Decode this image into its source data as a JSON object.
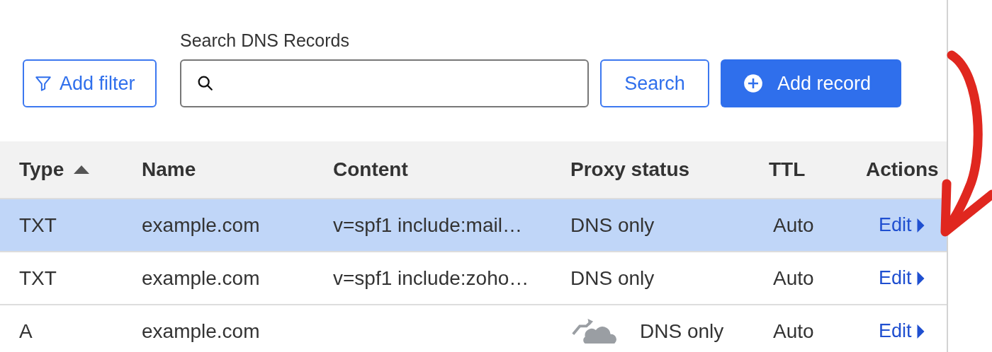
{
  "toolbar": {
    "add_filter": "Add filter",
    "search_label": "Search DNS Records",
    "search_button": "Search",
    "add_record": "Add record"
  },
  "table": {
    "columns": [
      {
        "label": "Type",
        "sorted": true
      },
      {
        "label": "Name"
      },
      {
        "label": "Content"
      },
      {
        "label": "Proxy status"
      },
      {
        "label": "TTL"
      },
      {
        "label": "Actions"
      }
    ],
    "rows": [
      {
        "type": "TXT",
        "name": "example.com",
        "content": "v=spf1 include:mail…",
        "kind": "plain",
        "proxy": "DNS only",
        "ttl": "Auto",
        "action": "Edit",
        "selected": true
      },
      {
        "type": "TXT",
        "name": "example.com",
        "content": "v=spf1 include:zoho…",
        "kind": "plain",
        "proxy": "DNS only",
        "ttl": "Auto",
        "action": "Edit",
        "selected": false
      },
      {
        "type": "A",
        "name": "example.com",
        "kind": "cloud",
        "proxy": "DNS only",
        "ttl": "Auto",
        "action": "Edit",
        "selected": false
      }
    ]
  },
  "annotation": {
    "kind": "arrow"
  }
}
